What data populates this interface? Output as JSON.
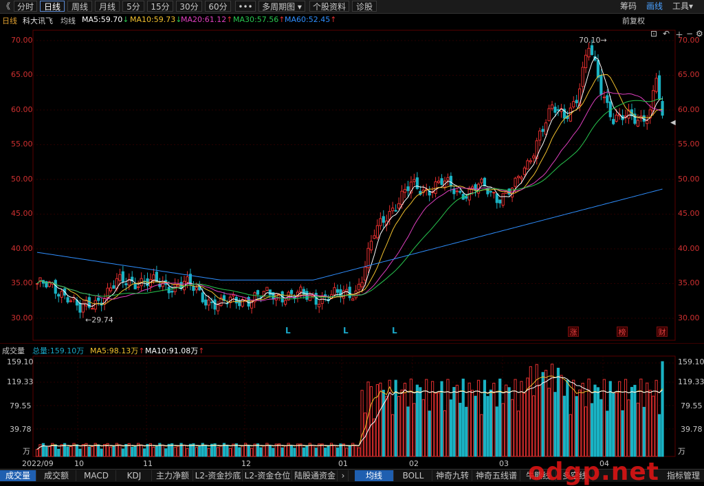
{
  "toolbar": {
    "back": "《",
    "items": [
      "分时",
      "日线",
      "周线",
      "月线",
      "5分",
      "15分",
      "30分",
      "60分",
      "•••",
      "多周期图",
      "个股资料",
      "诊股"
    ],
    "right": [
      "筹码",
      "画线",
      "工具"
    ]
  },
  "info": {
    "period": "日线",
    "name": "科大讯飞",
    "mode": "均线",
    "ma5": "MA5:59.70",
    "ma10": "MA10:59.73",
    "ma20": "MA20:61.12",
    "ma30": "MA30:57.56",
    "ma60": "MA60:52.45",
    "fq": "前复权",
    "colors": {
      "ma5": "#ffffff",
      "ma10": "#f2c12e",
      "ma20": "#e040c0",
      "ma30": "#28c850",
      "ma60": "#2f8fff"
    }
  },
  "price_axis": {
    "labels": [
      "70.00",
      "65.00",
      "60.00",
      "55.00",
      "50.00",
      "45.00",
      "40.00",
      "35.00",
      "30.00"
    ]
  },
  "annotations": {
    "high": "70.10",
    "low": "29.74",
    "l_mark": "L",
    "tags": [
      "涨",
      "榜",
      "财"
    ]
  },
  "volume": {
    "title": "成交量",
    "total": "总量:159.10万",
    "ma5": "MA5:98.13万",
    "ma10": "MA10:91.08万",
    "axis": [
      "159.10",
      "119.33",
      "79.55",
      "39.78",
      "万"
    ]
  },
  "x_axis": [
    "2022/09",
    "10",
    "11",
    "12",
    "01",
    "02",
    "03",
    "04"
  ],
  "bottom_tabs": [
    "成交量",
    "成交额",
    "MACD",
    "KDJ",
    "主力净额",
    "L2-资金抄底",
    "L2-资金仓位",
    "陆股通资金",
    "均线",
    "BOLL",
    "神奇九转",
    "神奇五线谱",
    "牛熊线",
    "多空线",
    "指标管理"
  ],
  "watermark": "odgp.net"
}
